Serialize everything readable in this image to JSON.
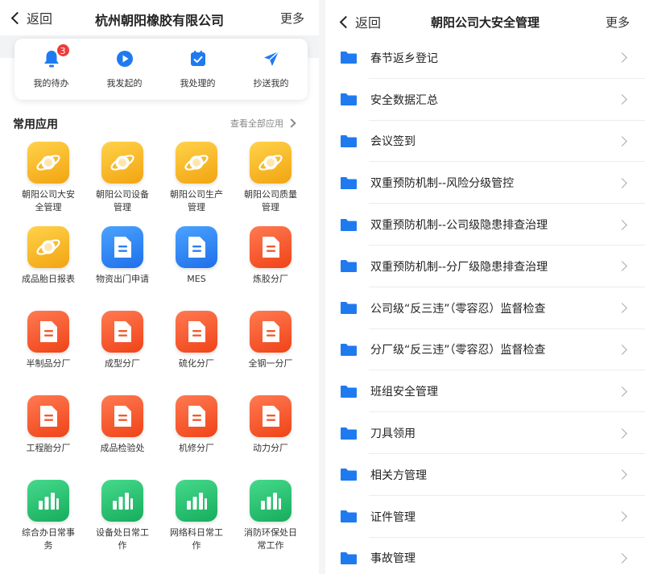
{
  "left": {
    "header": {
      "back_label": "返回",
      "title": "杭州朝阳橡胶有限公司",
      "more_label": "更多"
    },
    "quick_actions": [
      {
        "label": "我的待办",
        "icon": "bell-icon",
        "badge": "3"
      },
      {
        "label": "我发起的",
        "icon": "play-icon"
      },
      {
        "label": "我处理的",
        "icon": "check-box-icon"
      },
      {
        "label": "抄送我的",
        "icon": "paper-plane-icon"
      }
    ],
    "section": {
      "title": "常用应用",
      "view_all_label": "查看全部应用"
    },
    "apps": [
      {
        "label": "朝阳公司大安全管理",
        "color": "orange",
        "icon": "planet-icon"
      },
      {
        "label": "朝阳公司设备管理",
        "color": "orange",
        "icon": "planet-icon"
      },
      {
        "label": "朝阳公司生产管理",
        "color": "orange",
        "icon": "planet-icon"
      },
      {
        "label": "朝阳公司质量管理",
        "color": "orange",
        "icon": "planet-icon"
      },
      {
        "label": "成品胎日报表",
        "color": "orange",
        "icon": "planet-icon"
      },
      {
        "label": "物资出门申请",
        "color": "blue",
        "icon": "document-icon"
      },
      {
        "label": "MES",
        "color": "blue",
        "icon": "document-icon"
      },
      {
        "label": "炼胶分厂",
        "color": "red",
        "icon": "document-icon"
      },
      {
        "label": "半制品分厂",
        "color": "red",
        "icon": "document-icon"
      },
      {
        "label": "成型分厂",
        "color": "red",
        "icon": "document-icon"
      },
      {
        "label": "硫化分厂",
        "color": "red",
        "icon": "document-icon"
      },
      {
        "label": "全钢一分厂",
        "color": "red",
        "icon": "document-icon"
      },
      {
        "label": "工程胎分厂",
        "color": "red",
        "icon": "document-icon"
      },
      {
        "label": "成品检验处",
        "color": "red",
        "icon": "document-icon"
      },
      {
        "label": "机修分厂",
        "color": "red",
        "icon": "document-icon"
      },
      {
        "label": "动力分厂",
        "color": "red",
        "icon": "document-icon"
      },
      {
        "label": "综合办日常事务",
        "color": "green",
        "icon": "bar-chart-icon"
      },
      {
        "label": "设备处日常工作",
        "color": "green",
        "icon": "bar-chart-icon"
      },
      {
        "label": "网络科日常工作",
        "color": "green",
        "icon": "bar-chart-icon"
      },
      {
        "label": "消防环保处日常工作",
        "color": "green",
        "icon": "bar-chart-icon"
      }
    ]
  },
  "right": {
    "header": {
      "back_label": "返回",
      "title": "朝阳公司大安全管理",
      "more_label": "更多"
    },
    "folders": [
      "春节返乡登记",
      "安全数据汇总",
      "会议签到",
      "双重预防机制--风险分级管控",
      "双重预防机制--公司级隐患排查治理",
      "双重预防机制--分厂级隐患排查治理",
      "公司级“反三违”（零容忍）监督检查",
      "分厂级“反三违”（零容忍）监督检查",
      "班组安全管理",
      "刀具领用",
      "相关方管理",
      "证件管理",
      "事故管理"
    ]
  },
  "colors": {
    "accent_blue": "#1f7af0",
    "badge_red": "#ee3b3b"
  }
}
